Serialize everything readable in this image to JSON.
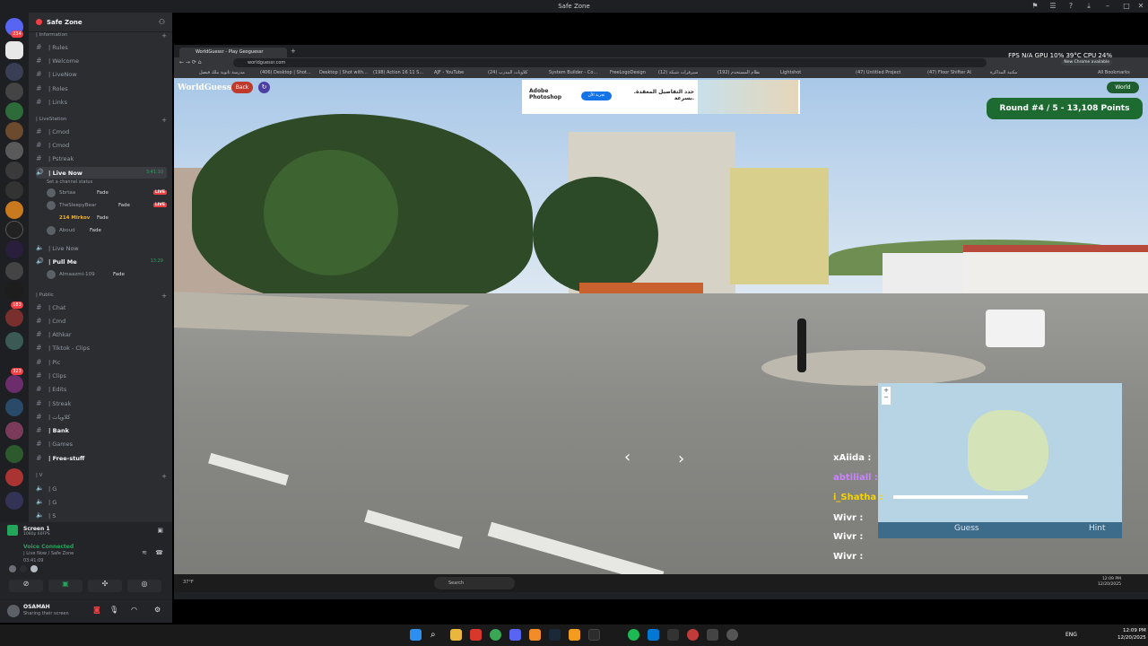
{
  "window": {
    "title": "Safe Zone"
  },
  "server_rail": {
    "badges": [
      "234",
      "183",
      "323"
    ]
  },
  "sidebar": {
    "server_name": "Safe Zone",
    "categories": {
      "information": "| Information",
      "livestation": "| LiveStation",
      "public": "| Public",
      "v": "| V"
    },
    "channels_info": [
      "| Rules",
      "| Welcome",
      "| LiveNow",
      "| Roles",
      "| Links"
    ],
    "channels_live": [
      "| Cmod",
      "| Cmod",
      "| Pstreak"
    ],
    "live_now": {
      "label": "| Live Now",
      "time": "3:41:10",
      "status": "Set a channel status"
    },
    "users": [
      {
        "name": "Sbrtaa",
        "tag": "Fade",
        "live": "LIVE"
      },
      {
        "name": "TheSleepyBear",
        "tag": "Fade",
        "live": "LIVE"
      },
      {
        "name": "214 Mirkov",
        "tag": "Fade",
        "live": ""
      },
      {
        "name": "Aboud",
        "tag": "Fade",
        "live": ""
      }
    ],
    "live_now2": "| Live Now",
    "pull_me": {
      "label": "| Pull Me",
      "time": "13:29"
    },
    "pull_user": {
      "name": "Almaazmi-109",
      "tag": "Fade"
    },
    "channels_public": [
      "| Chat",
      "| Cmd",
      "| Athkar",
      "| Tiktok - Clips",
      "| Pic",
      "| Clips",
      "| Edits",
      "| Streak",
      "| كلاويات",
      "| Bank",
      "| Games",
      "| Free-stuff"
    ],
    "channels_v": [
      "| G",
      "| G",
      "| S"
    ]
  },
  "voice": {
    "screen_title": "Screen 1",
    "screen_sub": "1080p 60FPS",
    "connected": "Voice Connected",
    "location": "| Live Now / Safe Zone",
    "time": "03:41:09"
  },
  "user": {
    "name": "OSAMAH",
    "status": "Sharing their screen"
  },
  "browser": {
    "tab_title": "WorldGuessr - Play Geoguessr",
    "url": "worldguessr.com",
    "stats": "FPS N/A   GPU 10% 39°C   CPU 24%",
    "new_chrome": "New Chrome available",
    "bookmarks": [
      "مدرسة ثانوية ملك فيصل",
      "(406) Desktop | Shot...",
      "Desktop | Shot with...",
      "(198) Action 16 11 S...",
      "AJF - YouTube",
      "(24) كلاويات المدرب",
      "System Builder - Co...",
      "FreeLogoDesign",
      "(12) سيرفرات شبكة",
      "(192) نظام المستخدم",
      "Lightshot",
      "(47) Untitled Project",
      "(47) Floor Shifter AI",
      "مكتبة المذاكرة",
      "All Bookmarks"
    ]
  },
  "game": {
    "logo": "WorldGuessr",
    "back": "Back",
    "world": "World",
    "round": "Round #4 / 5 - 13,108 Points",
    "ad_brand": "Adobe Photoshop",
    "ad_cta": "تجربة الآن",
    "ad_text": "حدد التفاصيل المعقدة. بسرعة.",
    "guess": "Guess",
    "hint": "Hint",
    "chat": [
      {
        "user": "xAiida :",
        "color": "#ffffff"
      },
      {
        "user": "abtiliall :",
        "color": "#c983ff"
      },
      {
        "user": "i_Shatha :",
        "color": "#f5d400"
      },
      {
        "user": "Wivr :",
        "color": "#ffffff"
      },
      {
        "user": "Wivr :",
        "color": "#ffffff"
      },
      {
        "user": "Wivr :",
        "color": "#ffffff"
      }
    ]
  },
  "stream_os": {
    "weather": "37°F",
    "search": "Search",
    "clock_time": "12:09 PM",
    "clock_date": "12/20/2025"
  },
  "taskbar": {
    "lang": "ENG",
    "time": "12:09 PM",
    "date": "12/20/2025"
  }
}
